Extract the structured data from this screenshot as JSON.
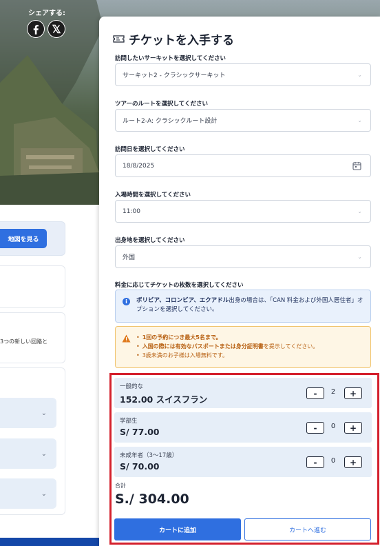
{
  "share": {
    "label": "シェアする:",
    "icons": [
      "facebook-icon",
      "x-icon"
    ]
  },
  "left": {
    "map_button": "地図を見る",
    "card_text": "3つの新しい回路と",
    "accordion_icon": "chevron-down-icon"
  },
  "panel": {
    "title": "チケットを入手する",
    "title_icon": "ticket-icon",
    "fields": [
      {
        "label": "訪問したいサーキットを選択してください",
        "value": "サーキット2 - クラシックサーキット",
        "icon": "chevron-down-icon"
      },
      {
        "label": "ツアーのルートを選択してください",
        "value": "ルート2-A: クラシックルート設計",
        "icon": "chevron-down-icon"
      },
      {
        "label": "訪問日を選択してください",
        "value": "18/8/2025",
        "icon": "calendar-icon"
      },
      {
        "label": "入場時間を選択してください",
        "value": "11:00",
        "icon": "chevron-down-icon"
      },
      {
        "label": "出身地を選択してください",
        "value": "外国",
        "icon": "chevron-down-icon"
      }
    ],
    "tickets_label": "料金に応じてチケットの枚数を選択してください",
    "info": {
      "bold": "ボリビア、コロンビア、エクアドル",
      "text": "出身の場合は、「CAN 料金および外国人居住者」オプションを選択してください。"
    },
    "warnings": [
      {
        "text": "1回の予約につき最大5名まで。",
        "bold_part": ""
      },
      {
        "prefix": "入国の際には",
        "bold": "有効なパスポートまたは身分証明書",
        "suffix": "を提示してください。"
      },
      {
        "text": "3歳未満のお子様は入場無料です。"
      }
    ],
    "tiers": [
      {
        "name": "一般的な",
        "price": "152.00 スイスフラン",
        "qty": "2"
      },
      {
        "name": "学部生",
        "price": "S/ 77.00",
        "qty": "0"
      },
      {
        "name": "未成年者（3～17歳）",
        "price": "S/ 70.00",
        "qty": "0"
      }
    ],
    "stepper": {
      "minus": "-",
      "plus": "+"
    },
    "total_label": "合計",
    "total_value": "S./ 304.00",
    "add_to_cart": "カートに追加",
    "go_to_cart": "カートへ進む"
  },
  "colors": {
    "primary": "#2f6fe0",
    "highlight_frame": "#d4202c",
    "warning": "#b75f10",
    "footer": "#1447a8"
  }
}
